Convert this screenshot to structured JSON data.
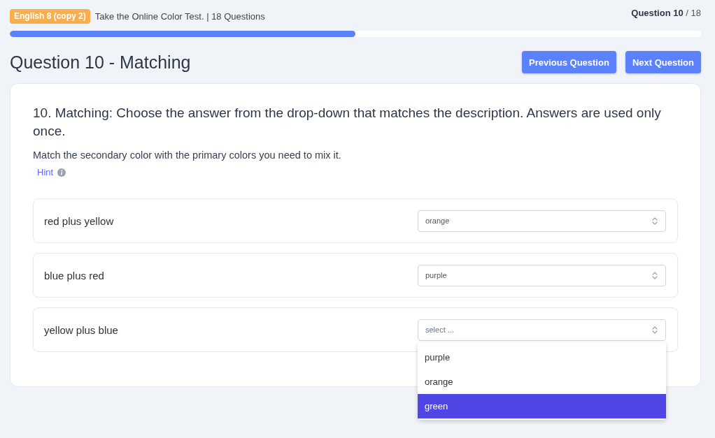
{
  "header": {
    "badge": "English 8 (copy 2)",
    "subtitle": "Take the Online Color Test. | 18 Questions",
    "counter": "**Question 10** / 18"
  },
  "progress": {
    "level": 0.5
  },
  "title": "Question 10 - Matching",
  "buttons": [
    "Previous Question",
    "Next Question"
  ],
  "question": {
    "prompt": "10. Matching: Choose the answer from the drop-down that matches the description. Answers are used only once.",
    "instruction": "Match the secondary color with the primary colors you need to mix it.",
    "hint": "Hint"
  },
  "pairs": [
    {
      "prompt": "red plus yellow",
      "value": "orange"
    },
    {
      "prompt": "blue plus red",
      "value": "purple"
    },
    {
      "prompt": "yellow plus blue",
      "placeholder": "select ...",
      "options": [
        {
          "label": "purple",
          "selected": false
        },
        {
          "label": "orange",
          "selected": false
        },
        {
          "label": "green",
          "selected": true
        }
      ]
    }
  ]
}
